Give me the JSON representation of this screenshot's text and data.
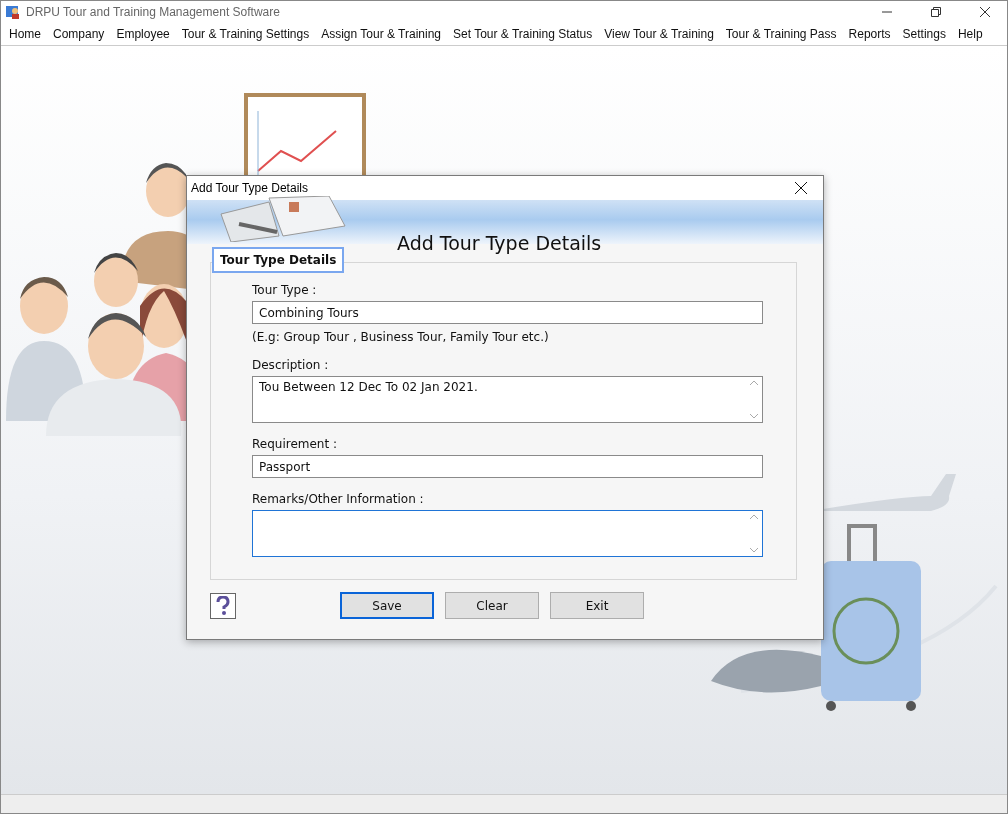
{
  "window": {
    "title": "DRPU Tour and Training Management Software"
  },
  "menu": [
    "Home",
    "Company",
    "Employee",
    "Tour & Training Settings",
    "Assign Tour & Training",
    "Set Tour & Training Status",
    "View Tour & Training",
    "Tour & Training Pass",
    "Reports",
    "Settings",
    "Help"
  ],
  "dialog": {
    "title": "Add Tour Type Details",
    "heading": "Add Tour Type Details",
    "group_title": "Tour Type Details",
    "fields": [
      {
        "label": "Tour Type :",
        "kind": "line",
        "value": "Combining Tours",
        "hint": "(E.g: Group Tour , Business Tour, Family Tour etc.)",
        "focused": false
      },
      {
        "label": "Description :",
        "kind": "area",
        "value": "Tou Between 12 Dec To 02 Jan 2021.",
        "focused": false
      },
      {
        "label": "Requirement :",
        "kind": "line",
        "value": "Passport",
        "focused": false
      },
      {
        "label": "Remarks/Other Information :",
        "kind": "area",
        "focused": true
      }
    ],
    "buttons": [
      {
        "label": "Save",
        "focused": true
      },
      {
        "label": "Clear",
        "focused": false
      },
      {
        "label": "Exit",
        "focused": false
      }
    ]
  }
}
